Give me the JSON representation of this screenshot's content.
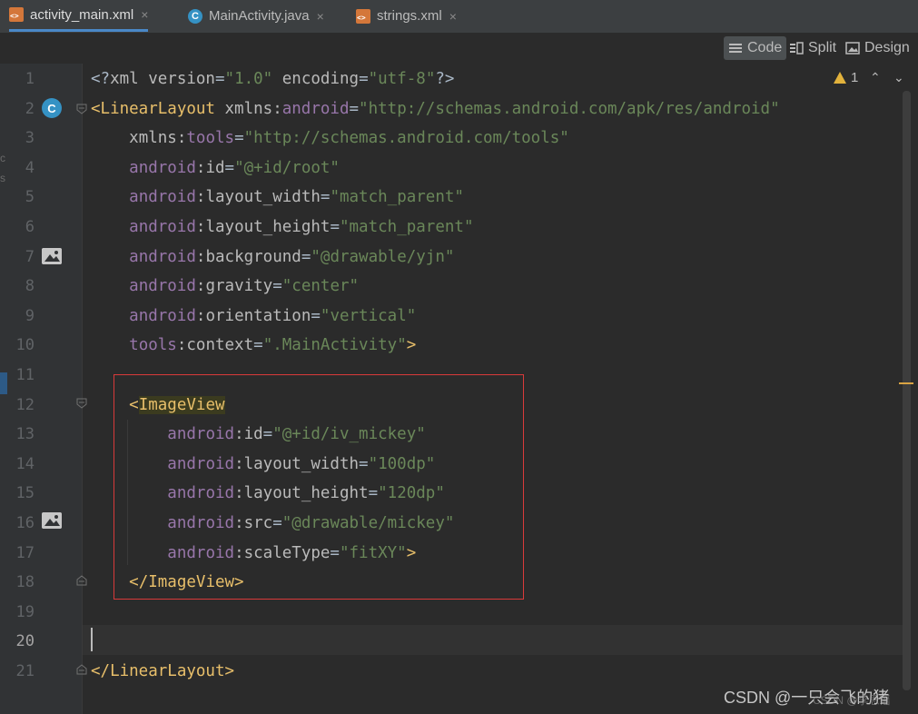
{
  "tabs": [
    {
      "label": "activity_main.xml",
      "icon": "xml-file-icon",
      "active": true
    },
    {
      "label": "MainActivity.java",
      "icon": "java-class-icon",
      "active": false
    },
    {
      "label": "strings.xml",
      "icon": "xml-file-icon",
      "active": false
    }
  ],
  "close_glyph": "×",
  "view_modes": {
    "code": "Code",
    "split": "Split",
    "design": "Design"
  },
  "inspection": {
    "count": "1",
    "up": "⌃",
    "down": "⌄"
  },
  "gutter_badge": "C",
  "line_numbers": [
    "1",
    "2",
    "3",
    "4",
    "5",
    "6",
    "7",
    "8",
    "9",
    "10",
    "11",
    "12",
    "13",
    "14",
    "15",
    "16",
    "17",
    "18",
    "19",
    "20",
    "21"
  ],
  "current_line": 20,
  "watermark": "CSDN @一只会飞的猪",
  "watermark_overlay": "CSDN @李思瑶",
  "colors": {
    "tag": "#e8bf6a",
    "namespace": "#9876aa",
    "value": "#6a8759",
    "highlight_box": "#d93a3a",
    "active_tab": "#4a88c7"
  }
}
